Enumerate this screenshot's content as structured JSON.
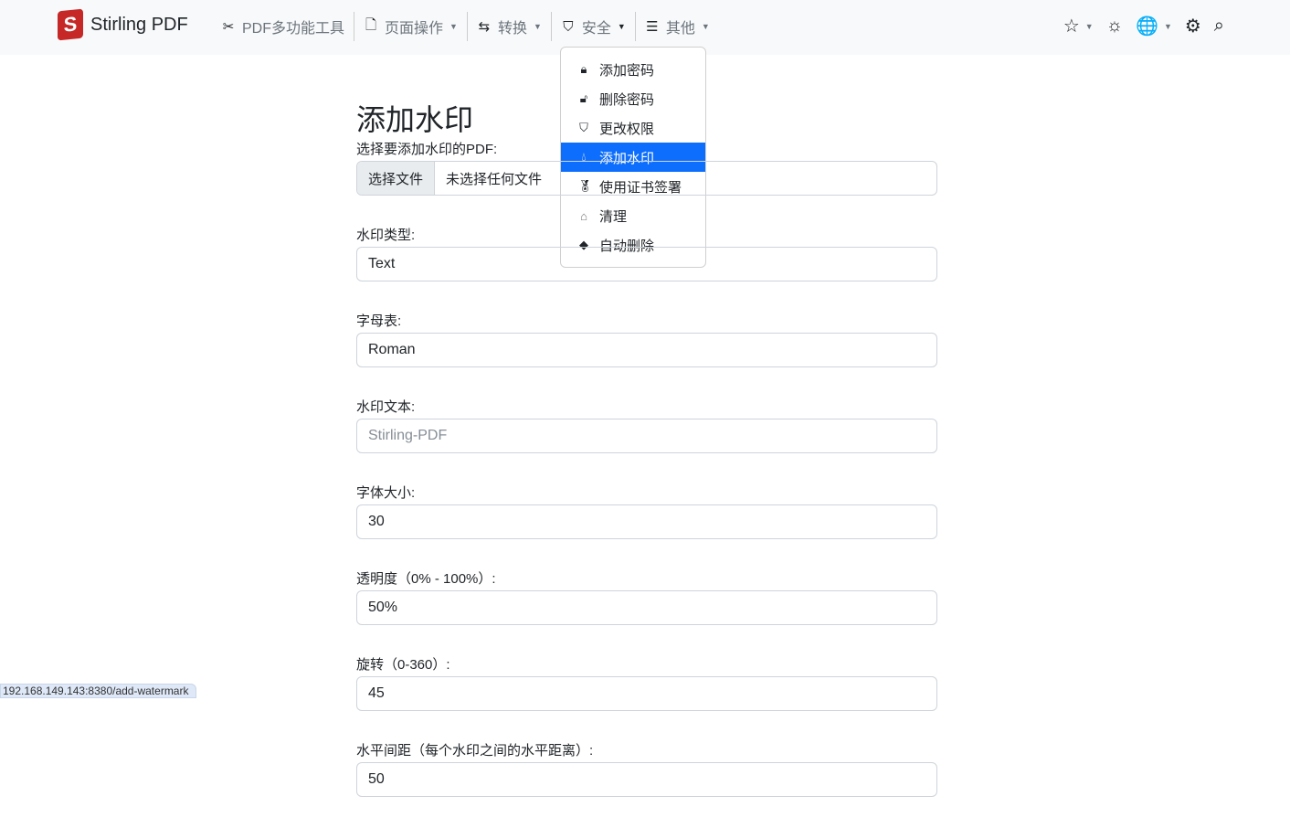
{
  "brand": {
    "name": "Stirling PDF",
    "logo_letter": "S"
  },
  "nav": {
    "items": [
      {
        "label": "PDF多功能工具",
        "icon": "scissors-icon"
      },
      {
        "label": "页面操作",
        "icon": "file-pdf-icon"
      },
      {
        "label": "转换",
        "icon": "arrows-icon"
      },
      {
        "label": "安全",
        "icon": "shield-icon"
      },
      {
        "label": "其他",
        "icon": "list-icon"
      }
    ]
  },
  "security_menu": [
    {
      "label": "添加密码",
      "icon": "lock-icon"
    },
    {
      "label": "删除密码",
      "icon": "unlock-icon"
    },
    {
      "label": "更改权限",
      "icon": "shield-lock-icon"
    },
    {
      "label": "添加水印",
      "icon": "droplet-icon",
      "active": true
    },
    {
      "label": "使用证书签署",
      "icon": "award-icon"
    },
    {
      "label": "清理",
      "icon": "sanitize-icon"
    },
    {
      "label": "自动删除",
      "icon": "eraser-icon"
    }
  ],
  "page": {
    "title": "添加水印",
    "file_label": "选择要添加水印的PDF:",
    "file_button": "选择文件",
    "file_status": "未选择任何文件",
    "fields": [
      {
        "label": "水印类型:",
        "value": "Text"
      },
      {
        "label": "字母表:",
        "value": "Roman"
      },
      {
        "label": "水印文本:",
        "placeholder": "Stirling-PDF"
      },
      {
        "label": "字体大小:",
        "value": "30"
      },
      {
        "label": "透明度（0% - 100%）:",
        "value": "50%"
      },
      {
        "label": "旋转（0-360）:",
        "value": "45"
      },
      {
        "label": "水平间距（每个水印之间的水平距离）:",
        "value": "50"
      }
    ]
  },
  "status_url": "192.168.149.143:8380/add-watermark",
  "colors": {
    "accent": "#0d6efd",
    "navbar": "#f8f9fa"
  }
}
